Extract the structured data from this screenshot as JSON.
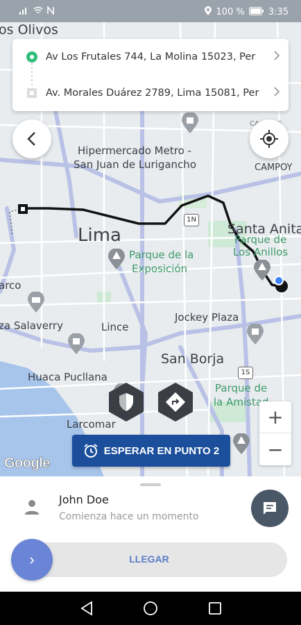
{
  "status": {
    "battery": "100 %",
    "time": "3:35"
  },
  "route": {
    "origin": "Av Los Frutales 744, La Molina 15023, Per",
    "destination": "Av. Morales Duárez 2789, Lima 15081, Per"
  },
  "map": {
    "labels": {
      "los_olivos": "os Olivos",
      "hipermercado": "Hipermercado Metro -",
      "san_juan": "San Juan de Lurigancho",
      "campoy": "CAMPOY",
      "lima": "Lima",
      "santa_anita": "Santa Anita",
      "parque_anillos_1": "Parque de",
      "parque_anillos_2": "Los Anillos",
      "parque_expo_1": "Parque de la",
      "parque_expo_2": "Exposición",
      "marco": "arco",
      "jockey": "Jockey Plaza",
      "salaverry": "za Salaverry",
      "lince": "Lince",
      "san_borja": "San Borja",
      "huaca": "Huaca Pucllana",
      "parque_amistad_1": "Parque de",
      "parque_amistad_2": "la Amistad",
      "larcomar": "Larcomar",
      "shield_1n": "1N",
      "shield_1s": "1S",
      "caceres": "CACERES"
    },
    "attribution": "Google",
    "zoom_in": "+",
    "zoom_out": "−"
  },
  "actions": {
    "wait_label": "ESPERAR EN PUNTO 2"
  },
  "rider": {
    "name": "John Doe",
    "subtitle": "Comienza hace un momento"
  },
  "slider": {
    "label": "LLEGAR",
    "knob": "›"
  },
  "colors": {
    "primary": "#1b4f9c",
    "slider_knob": "#6a84d6",
    "origin_dot": "#2ebd7a",
    "chat_button": "#4a5766"
  },
  "icons": {
    "back": "back-arrow-icon",
    "locate": "my-location-icon",
    "alarm": "alarm-clock-icon",
    "shield": "shield-icon",
    "directions": "directions-icon",
    "person": "person-icon",
    "chat": "chat-icon"
  }
}
